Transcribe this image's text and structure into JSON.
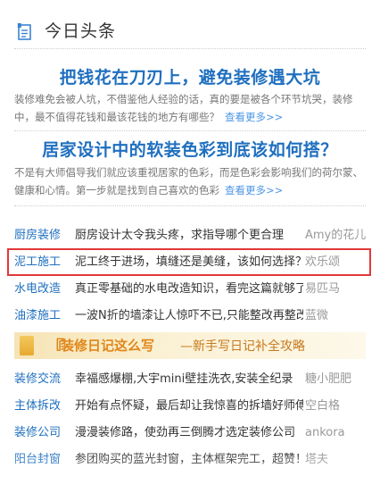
{
  "header": {
    "title": "今日头条",
    "icon": "news-icon"
  },
  "headline1": {
    "title": "把钱花在刀刃上，避免装修遇大坑",
    "summary": "装修难免会被人坑，不借鉴他人经验的话，真的要是被各个环节坑哭，装修中，最不值得花钱和最该花钱的地方有哪些？",
    "more": "查看更多>>"
  },
  "headline2": {
    "title": "居家设计中的软装色彩到底该如何搭？",
    "summary": "不是有大师倡导我们就应该重视居家的色彩，而是色彩会影响我们的荷尔蒙、健康和心情。第一步就是找到自己喜欢的色彩",
    "more": "查看更多>>"
  },
  "articles_top": [
    {
      "category": "厨房装修",
      "title": "厨房设计太令我头疼，求指导哪个更合理",
      "author": "Amy的花儿"
    },
    {
      "category": "泥工施工",
      "title": "泥工终于进场，填缝还是美缝，该如何选择？",
      "author": "欢乐颂"
    },
    {
      "category": "水电改造",
      "title": "真正零基础的水电改造知识，看完这篇就够了",
      "author": "易匹马"
    },
    {
      "category": "油漆施工",
      "title": "一波N折的墙漆让人惊吓不已,只能整改再整改",
      "author": "蓝微"
    }
  ],
  "banner": {
    "quote_mark": "『",
    "title": "装修日记这么写",
    "subtitle": "—新手写日记补全攻略"
  },
  "articles_bottom": [
    {
      "category": "装修交流",
      "title": "幸福感爆棚,大宇mini壁挂洗衣,安装全纪录",
      "author": "糖小肥肥"
    },
    {
      "category": "主体拆改",
      "title": "开始有点怀疑，最后却让我惊喜的拆墙好师傅",
      "author": "空白格"
    },
    {
      "category": "装修公司",
      "title": "漫漫装修路，使劲再三倒腾才选定装修公司",
      "author": "ankora"
    },
    {
      "category": "阳台封窗",
      "title": "参团购买的蓝光封窗，主体框架完工，超赞！",
      "author": "塔夫"
    }
  ],
  "colors": {
    "link": "#1f6fbf",
    "more": "#4c96e6",
    "highlight_border": "#e23838",
    "banner": "#f6e4b6"
  }
}
